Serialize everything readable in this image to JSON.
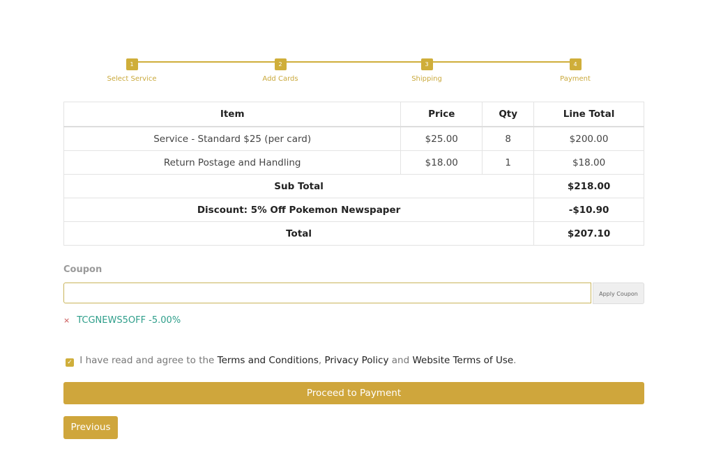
{
  "stepper": {
    "steps": [
      {
        "num": "1",
        "label": "Select Service"
      },
      {
        "num": "2",
        "label": "Add Cards"
      },
      {
        "num": "3",
        "label": "Shipping"
      },
      {
        "num": "4",
        "label": "Payment"
      }
    ]
  },
  "table": {
    "headers": [
      "Item",
      "Price",
      "Qty",
      "Line Total"
    ],
    "rows": [
      {
        "item": "Service - Standard $25 (per card)",
        "price": "$25.00",
        "qty": "8",
        "line_total": "$200.00"
      },
      {
        "item": "Return Postage and Handling",
        "price": "$18.00",
        "qty": "1",
        "line_total": "$18.00"
      }
    ],
    "subtotal": {
      "label": "Sub Total",
      "value": "$218.00"
    },
    "discount": {
      "label": "Discount: 5% Off Pokemon Newspaper",
      "value": "-$10.90"
    },
    "total": {
      "label": "Total",
      "value": "$207.10"
    }
  },
  "coupon": {
    "label": "Coupon",
    "value": "",
    "apply_label": "Apply Coupon",
    "applied_code": "TCGNEWS5OFF -5.00%",
    "remove_icon": "×"
  },
  "terms": {
    "prefix": "I have read and agree to the",
    "link1": "Terms and Conditions",
    "sep": ",",
    "link2": "Privacy Policy",
    "and": "and",
    "link3": "Website Terms of Use",
    "suffix": ".",
    "checked": true
  },
  "buttons": {
    "proceed": "Proceed to Payment",
    "previous": "Previous"
  },
  "colors": {
    "accent": "#cfa63c",
    "coupon_text": "#2e9e8a",
    "remove": "#c74d4d"
  }
}
